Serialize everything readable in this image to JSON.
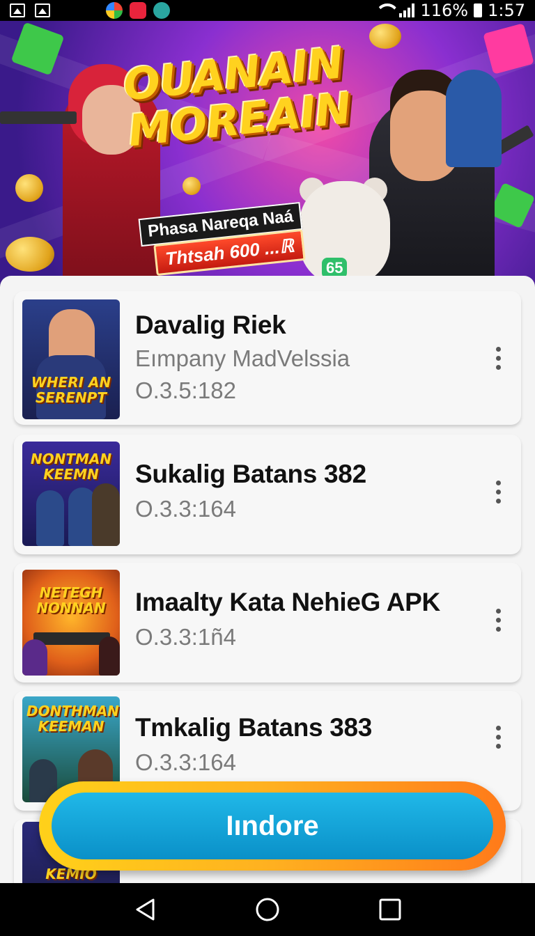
{
  "status_bar": {
    "battery": "116%",
    "time": "1:57",
    "icons": [
      "gallery-icon",
      "gallery-icon",
      "app-icon-1",
      "app-icon-2",
      "app-icon-3",
      "wifi-icon",
      "signal-icon",
      "battery-icon"
    ]
  },
  "banner": {
    "title_line1": "OUANAIN",
    "title_line2": "MOREAIN",
    "subtitle": "Phasa Nareqa Naá",
    "promo": "Thtsah 600 ...ℝ",
    "bear_badge": "65"
  },
  "list": {
    "items": [
      {
        "title": "Davalig Riek",
        "publisher": "Eımpany MadVelssia",
        "version": "O.3.5:182",
        "thumb_text": "WHERI AN SERENPT"
      },
      {
        "title": "Sukalig Batans 382",
        "version": "O.3.3:164",
        "thumb_text": "NONTMAN KEEMN"
      },
      {
        "title": "Imaalty Kata NehieG APK",
        "version": "O.3.3:1ñ4",
        "thumb_text": "NETEGH NONNAN"
      },
      {
        "title": "Tmkalig Batans 383",
        "version": "O.3.3:164",
        "thumb_text": "DONTHMAN KEEMAN"
      },
      {
        "thumb_text": "KEMIO"
      }
    ]
  },
  "cta": {
    "label": "Iındore"
  },
  "colors": {
    "accent": "#12a6dc",
    "cta_border": "#ffb020",
    "banner_bg": "#8a2fd0"
  }
}
